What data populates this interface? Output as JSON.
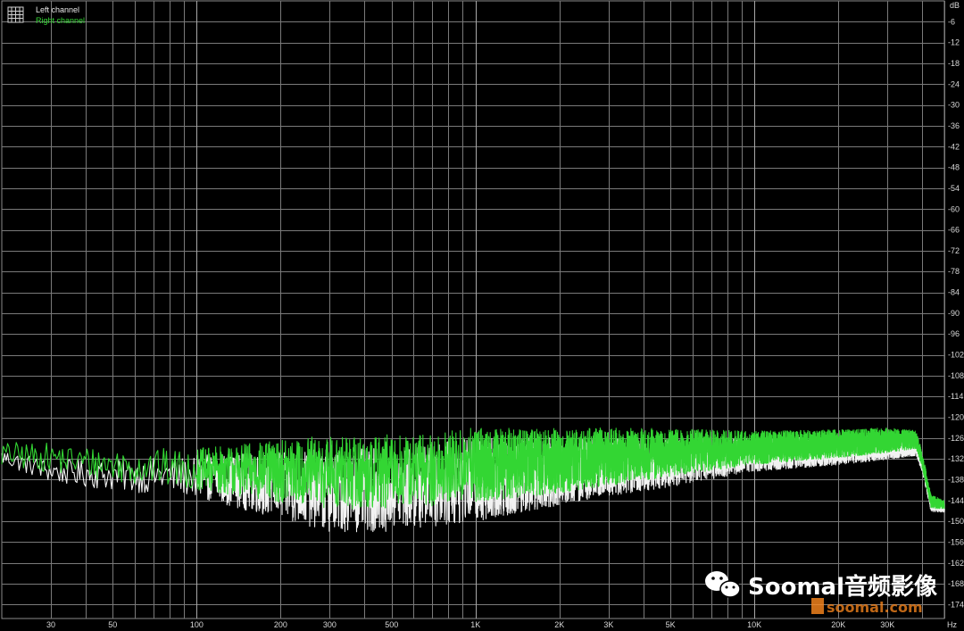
{
  "chart_data": {
    "type": "line",
    "ylabel": "dB",
    "xlabel": "Hz",
    "xscale": "log",
    "xlim": [
      20,
      48000
    ],
    "ylim": [
      -178,
      0
    ],
    "y_ticks": [
      -6,
      -12,
      -18,
      -24,
      -30,
      -36,
      -42,
      -48,
      -54,
      -60,
      -66,
      -72,
      -78,
      -84,
      -90,
      -96,
      -102,
      -108,
      -114,
      -120,
      -126,
      -132,
      -138,
      -144,
      -150,
      -156,
      -162,
      -168,
      -174
    ],
    "x_ticks": [
      {
        "value": 30,
        "label": "30"
      },
      {
        "value": 50,
        "label": "50"
      },
      {
        "value": 100,
        "label": "100"
      },
      {
        "value": 200,
        "label": "200"
      },
      {
        "value": 300,
        "label": "300"
      },
      {
        "value": 500,
        "label": "500"
      },
      {
        "value": 1000,
        "label": "1K"
      },
      {
        "value": 2000,
        "label": "2K"
      },
      {
        "value": 3000,
        "label": "3K"
      },
      {
        "value": 5000,
        "label": "5K"
      },
      {
        "value": 10000,
        "label": "10K"
      },
      {
        "value": 20000,
        "label": "20K"
      },
      {
        "value": 30000,
        "label": "30K"
      }
    ],
    "grid": true,
    "legend_position": "top-left",
    "series": [
      {
        "name": "Left channel",
        "color": "#f2f2f2",
        "envelope": [
          [
            20,
            -131
          ],
          [
            30,
            -135
          ],
          [
            50,
            -136
          ],
          [
            100,
            -136
          ],
          [
            200,
            -138
          ],
          [
            300,
            -139
          ],
          [
            500,
            -139
          ],
          [
            1000,
            -136
          ],
          [
            2000,
            -134
          ],
          [
            3000,
            -133
          ],
          [
            5000,
            -132
          ],
          [
            10000,
            -130
          ],
          [
            20000,
            -129
          ],
          [
            30000,
            -128
          ],
          [
            38000,
            -128
          ],
          [
            40000,
            -133
          ],
          [
            43000,
            -145
          ],
          [
            48000,
            -146
          ]
        ],
        "spread": [
          [
            20,
            2
          ],
          [
            100,
            5
          ],
          [
            300,
            10
          ],
          [
            1000,
            10
          ],
          [
            3000,
            7
          ],
          [
            10000,
            4
          ],
          [
            30000,
            3
          ],
          [
            40000,
            2
          ],
          [
            48000,
            1
          ]
        ]
      },
      {
        "name": "Right channel",
        "color": "#33d633",
        "envelope": [
          [
            20,
            -130
          ],
          [
            30,
            -131
          ],
          [
            50,
            -133
          ],
          [
            100,
            -134
          ],
          [
            200,
            -134
          ],
          [
            300,
            -134
          ],
          [
            500,
            -134
          ],
          [
            1000,
            -132
          ],
          [
            2000,
            -131
          ],
          [
            3000,
            -130
          ],
          [
            5000,
            -129
          ],
          [
            10000,
            -128
          ],
          [
            20000,
            -127
          ],
          [
            30000,
            -126
          ],
          [
            38000,
            -126
          ],
          [
            40000,
            -132
          ],
          [
            43000,
            -144
          ],
          [
            48000,
            -145
          ]
        ],
        "spread": [
          [
            20,
            3
          ],
          [
            100,
            5
          ],
          [
            300,
            9
          ],
          [
            1000,
            9
          ],
          [
            3000,
            7
          ],
          [
            10000,
            4
          ],
          [
            30000,
            3
          ],
          [
            40000,
            2
          ],
          [
            48000,
            1
          ]
        ]
      }
    ]
  },
  "legend": {
    "left_label": "Left channel",
    "right_label": "Right channel"
  },
  "axis": {
    "y_unit": "dB",
    "x_unit": "Hz"
  },
  "watermark": {
    "main": "Soomal音频影像",
    "sub": "soomal.com"
  }
}
